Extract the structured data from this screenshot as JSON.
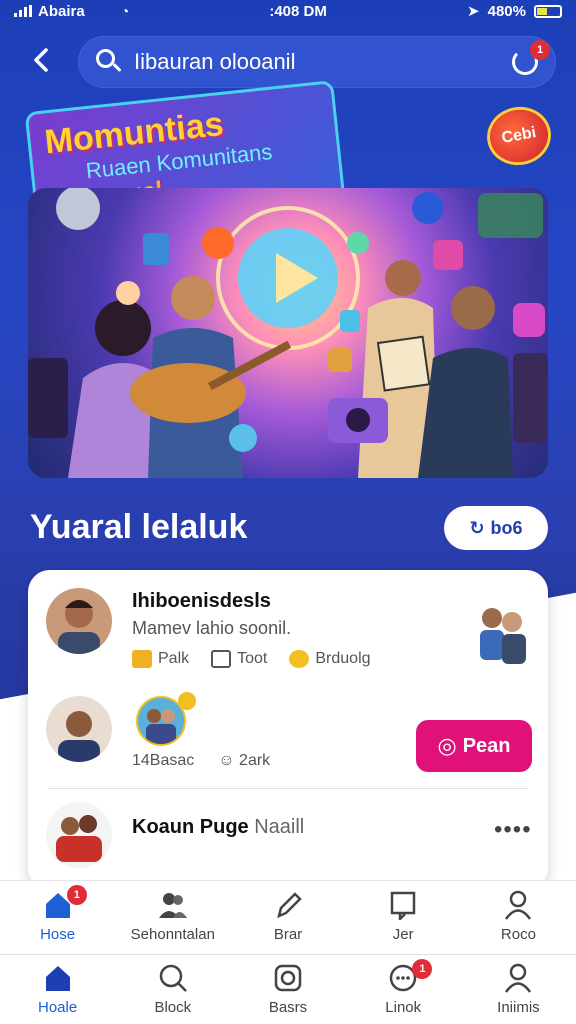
{
  "status_bar": {
    "carrier": "Abaira",
    "time": ":408 DM",
    "battery": "480%"
  },
  "search": {
    "value": "Iibauran olooanil",
    "badge": "1"
  },
  "banner": {
    "line1": "Momuntias",
    "line2": "Ruaen Komunitans",
    "line3": "Ineanoual",
    "logo": "Cebi"
  },
  "section": {
    "title": "Yuaral lelaluk",
    "pill_label": "bo6"
  },
  "feed": {
    "row1": {
      "name": "Ihiboenisdesls",
      "subtitle": "Mamev lahio soonil.",
      "actions": [
        "Palk",
        "Toot",
        "Brduolg"
      ]
    },
    "row2": {
      "meta": [
        "14Basac",
        "2ark"
      ],
      "button": "Pean"
    },
    "row3": {
      "name_bold": "Koaun Puge",
      "name_rest": "Naaill"
    }
  },
  "tabs": [
    {
      "label": "Hose",
      "icon": "home-icon",
      "badge": "1"
    },
    {
      "label": "Sehonntalan",
      "icon": "people-icon"
    },
    {
      "label": "Brar",
      "icon": "pen-icon"
    },
    {
      "label": "Jer",
      "icon": "book-icon"
    },
    {
      "label": "Roco",
      "icon": "user-icon"
    }
  ],
  "bottom_nav": [
    {
      "label": "Hoale",
      "icon": "home-icon"
    },
    {
      "label": "Block",
      "icon": "search-icon"
    },
    {
      "label": "Basrs",
      "icon": "camera-icon"
    },
    {
      "label": "Linok",
      "icon": "chat-icon",
      "badge": "1"
    },
    {
      "label": "Iniimis",
      "icon": "user-icon"
    }
  ],
  "colors": {
    "primary": "#1c3fb8",
    "accent_pink": "#e0127a",
    "active_tab": "#1e5fd6"
  }
}
